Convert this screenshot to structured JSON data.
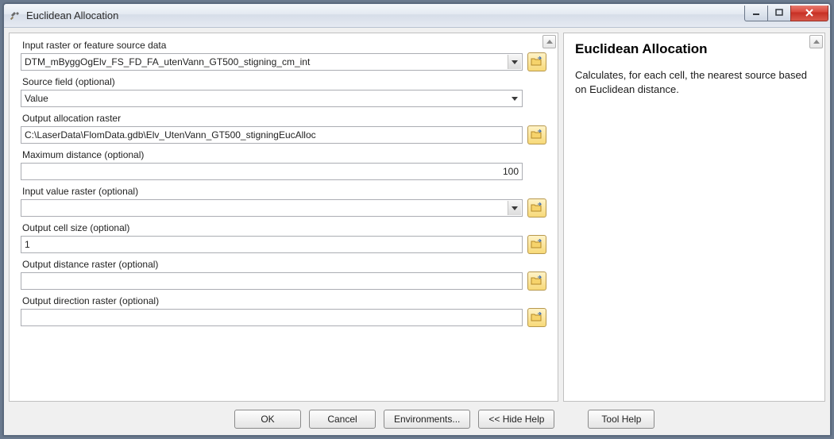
{
  "window": {
    "title": "Euclidean Allocation"
  },
  "fields": {
    "input_source": {
      "label": "Input raster or feature source data",
      "value": "DTM_mByggOgElv_FS_FD_FA_utenVann_GT500_stigning_cm_int"
    },
    "source_field": {
      "label": "Source field (optional)",
      "value": "Value"
    },
    "output_alloc": {
      "label": "Output allocation raster",
      "value": "C:\\LaserData\\FlomData.gdb\\Elv_UtenVann_GT500_stigningEucAlloc"
    },
    "max_distance": {
      "label": "Maximum distance (optional)",
      "value": "100"
    },
    "input_value_raster": {
      "label": "Input value raster (optional)",
      "value": ""
    },
    "output_cell_size": {
      "label": "Output cell size (optional)",
      "value": "1"
    },
    "output_dist_raster": {
      "label": "Output distance raster (optional)",
      "value": ""
    },
    "output_dir_raster": {
      "label": "Output direction raster (optional)",
      "value": ""
    }
  },
  "buttons": {
    "ok": "OK",
    "cancel": "Cancel",
    "environments": "Environments...",
    "hide_help": "<< Hide Help",
    "tool_help": "Tool Help"
  },
  "help": {
    "title": "Euclidean Allocation",
    "body": "Calculates, for each cell, the nearest source based on Euclidean distance."
  }
}
